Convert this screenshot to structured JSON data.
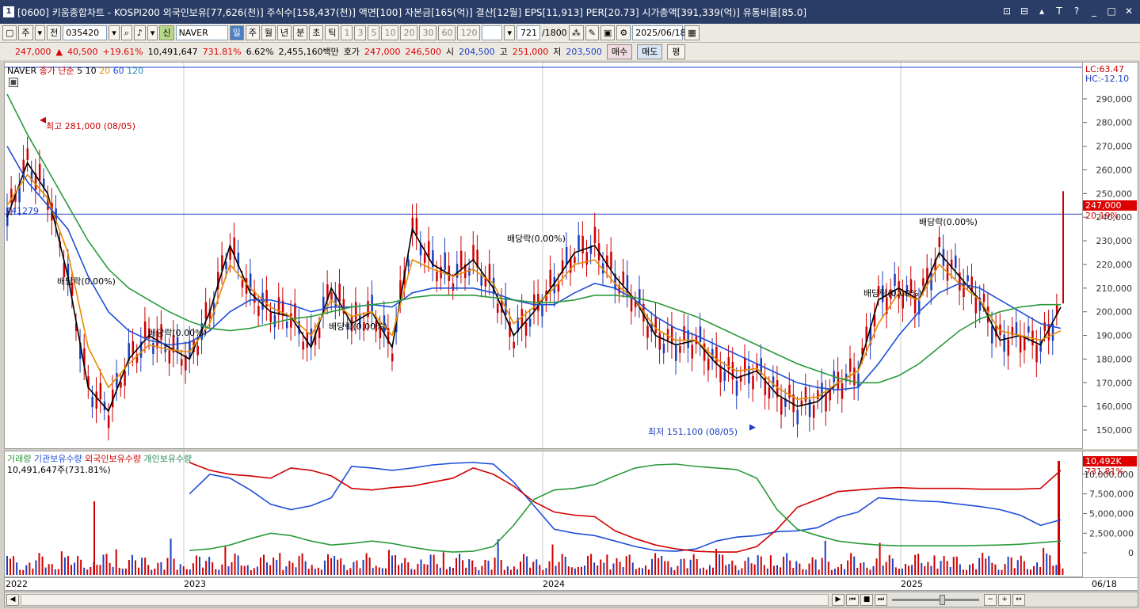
{
  "window": {
    "id": "1",
    "title": "[0600] 키움종합차트 - KOSPI200 외국인보유[77,626(천)] 주식수[158,437(천)] 액면[100] 자본금[165(억)] 결산[12월] EPS[11,913] PER[20.73] 시가총액[391,339(억)] 유통비율[85.0]",
    "buttons": [
      "⊡",
      "⊟",
      "▴",
      "T",
      "?",
      "_",
      "□",
      "✕"
    ]
  },
  "toolbar": {
    "mode_main": "주",
    "mode_all": "전",
    "code": "035420",
    "name": "NAVER",
    "badge": "신",
    "periods": [
      "일",
      "주",
      "월",
      "년",
      "분",
      "초",
      "틱"
    ],
    "active_period": "일",
    "intervals": [
      "1",
      "3",
      "5",
      "10",
      "20",
      "30",
      "60",
      "120"
    ],
    "count": "721",
    "count_total": "/1800",
    "date": "2025/06/18"
  },
  "price": {
    "current": "247,000",
    "arrow": "▲",
    "change": "40,500",
    "change_pct": "+19.61%",
    "volume": "10,491,647",
    "volume_pct": "731.81%",
    "turnover": "6.62%",
    "amount": "2,455,160백만",
    "quote_label": "호가",
    "ask": "247,000",
    "bid": "246,500",
    "open_label": "시",
    "open": "204,500",
    "high_label": "고",
    "high": "251,000",
    "low_label": "저",
    "low": "203,500",
    "buy": "매수",
    "sell": "매도",
    "eval": "평"
  },
  "main_legend": {
    "name": "NAVER",
    "ma_label": "종가 단순",
    "ma": [
      {
        "label": "5",
        "color": "#000000"
      },
      {
        "label": "10",
        "color": "#000000"
      },
      {
        "label": "20",
        "color": "#e88a00"
      },
      {
        "label": "60",
        "color": "#1f4fd8"
      },
      {
        "label": "120",
        "color": "#2a9a3a"
      }
    ]
  },
  "right_header": {
    "lc": "LC:63.47",
    "hc": "HC:-12.10"
  },
  "price_tag": {
    "value": "247,000",
    "pct": "20.19%"
  },
  "volume_tag": {
    "value": "10,492K",
    "pct": "731.81%"
  },
  "volume_legend": {
    "items": [
      {
        "label": "거래량",
        "color": "#2a9a3a"
      },
      {
        "label": "기관보유수량",
        "color": "#1f4fd8"
      },
      {
        "label": "외국인보유수량",
        "color": "#d00000"
      },
      {
        "label": "개인보유수량",
        "color": "#2a8a5a"
      }
    ],
    "volume_text": "10,491,647주(731.81%)"
  },
  "ref_line": {
    "value": 241279,
    "label": "241279"
  },
  "annotations": {
    "high": "최고 281,000 (08/05)",
    "low": "최저 151,100 (08/05)",
    "dividends": [
      "배당락(0.00%)",
      "배당락(0.00%)",
      "배당락(0.00%)",
      "배당락(0.00%)",
      "배당락(0.00%)",
      "배당락(0.00%)"
    ]
  },
  "date_axis": {
    "labels": [
      "2022",
      "2023",
      "2024",
      "2025",
      "06/18"
    ]
  },
  "scroll_buttons": [
    "◀",
    "▶",
    "⏮",
    "■",
    "⏭",
    "−",
    "+",
    "↔"
  ],
  "chart_data": [
    {
      "type": "line",
      "title": "NAVER",
      "ylim": [
        145000,
        300000
      ],
      "yticks": [
        "290,000",
        "280,000",
        "270,000",
        "260,000",
        "250,000",
        "240,000",
        "230,000",
        "220,000",
        "210,000",
        "200,000",
        "190,000",
        "180,000",
        "170,000",
        "160,000",
        "150,000"
      ],
      "series": [
        {
          "name": "5",
          "color": "#000000",
          "values": [
            240000,
            263000,
            250000,
            215000,
            168000,
            158000,
            180000,
            190000,
            185000,
            180000,
            200000,
            228000,
            208000,
            200000,
            198000,
            185000,
            210000,
            195000,
            200000,
            185000,
            235000,
            220000,
            215000,
            222000,
            210000,
            190000,
            200000,
            212000,
            225000,
            228000,
            215000,
            205000,
            190000,
            186000,
            188000,
            178000,
            172000,
            175000,
            165000,
            160000,
            162000,
            170000,
            175000,
            205000,
            210000,
            205000,
            225000,
            215000,
            205000,
            188000,
            190000,
            186000,
            202000
          ]
        },
        {
          "name": "20",
          "color": "#e88a00",
          "values": [
            245000,
            258000,
            248000,
            225000,
            185000,
            168000,
            178000,
            186000,
            184000,
            183000,
            195000,
            220000,
            210000,
            202000,
            198000,
            190000,
            205000,
            198000,
            200000,
            190000,
            222000,
            218000,
            215000,
            218000,
            212000,
            195000,
            202000,
            210000,
            220000,
            222000,
            212000,
            205000,
            193000,
            188000,
            188000,
            180000,
            175000,
            176000,
            168000,
            163000,
            164000,
            170000,
            175000,
            195000,
            208000,
            205000,
            220000,
            212000,
            205000,
            192000,
            190000,
            188000,
            192000
          ]
        },
        {
          "name": "60",
          "color": "#1f4fd8",
          "values": [
            270000,
            255000,
            245000,
            235000,
            215000,
            200000,
            192000,
            188000,
            186000,
            187000,
            192000,
            200000,
            205000,
            205000,
            203000,
            200000,
            202000,
            202000,
            203000,
            202000,
            208000,
            210000,
            210000,
            210000,
            208000,
            205000,
            203000,
            203000,
            208000,
            212000,
            210000,
            205000,
            198000,
            193000,
            190000,
            186000,
            182000,
            178000,
            174000,
            170000,
            168000,
            167000,
            168000,
            178000,
            190000,
            200000,
            208000,
            212000,
            210000,
            205000,
            200000,
            195000,
            193000
          ]
        },
        {
          "name": "120",
          "color": "#2a9a3a",
          "values": [
            292000,
            275000,
            260000,
            245000,
            230000,
            218000,
            210000,
            205000,
            200000,
            196000,
            193000,
            192000,
            193000,
            195000,
            197000,
            198000,
            200000,
            202000,
            203000,
            204000,
            206000,
            207000,
            207000,
            207000,
            206000,
            205000,
            204000,
            204000,
            205000,
            207000,
            207000,
            206000,
            204000,
            201000,
            198000,
            194000,
            190000,
            186000,
            182000,
            178000,
            175000,
            172000,
            170000,
            170000,
            173000,
            178000,
            185000,
            192000,
            197000,
            200000,
            202000,
            203000,
            203000
          ]
        }
      ]
    },
    {
      "type": "line",
      "title": "거래량",
      "ylim": [
        -1000000,
        11500000
      ],
      "yticks": [
        "10,000,000",
        "7,500,000",
        "5,000,000",
        "2,500,000",
        "0"
      ],
      "series": [
        {
          "name": "기관보유수량",
          "color": "#1f4fd8",
          "values": [
            null,
            null,
            null,
            null,
            null,
            null,
            null,
            null,
            null,
            7500000,
            10000000,
            9500000,
            8000000,
            6200000,
            5500000,
            6000000,
            7000000,
            11000000,
            10800000,
            10500000,
            10800000,
            11200000,
            11400000,
            11500000,
            11300000,
            9000000,
            6000000,
            3000000,
            2500000,
            2200000,
            1500000,
            800000,
            300000,
            200000,
            500000,
            1500000,
            2000000,
            2200000,
            2700000,
            2800000,
            3200000,
            4500000,
            5200000,
            7000000,
            6800000,
            6600000,
            6500000,
            6200000,
            5900000,
            5500000,
            4800000,
            3500000,
            4200000
          ]
        },
        {
          "name": "외국인보유수량",
          "color": "#d00000",
          "values": [
            null,
            null,
            null,
            null,
            null,
            null,
            null,
            null,
            null,
            11500000,
            10500000,
            10000000,
            9800000,
            9500000,
            10800000,
            10500000,
            9800000,
            8200000,
            8000000,
            8300000,
            8500000,
            9000000,
            9500000,
            10800000,
            10000000,
            8500000,
            6500000,
            5200000,
            4800000,
            4600000,
            2800000,
            1800000,
            1000000,
            500000,
            200000,
            100000,
            100000,
            800000,
            3000000,
            5800000,
            6800000,
            7800000,
            8000000,
            8200000,
            8300000,
            8200000,
            8200000,
            8200000,
            8100000,
            8100000,
            8100000,
            8200000,
            10500000
          ]
        },
        {
          "name": "개인보유수량",
          "color": "#2a9a3a",
          "values": [
            null,
            null,
            null,
            null,
            null,
            null,
            null,
            null,
            null,
            300000,
            500000,
            1000000,
            1800000,
            2500000,
            2200000,
            1500000,
            1000000,
            1200000,
            1500000,
            1200000,
            700000,
            300000,
            100000,
            200000,
            800000,
            3500000,
            6800000,
            8000000,
            8200000,
            8700000,
            9800000,
            10800000,
            11200000,
            11300000,
            11000000,
            10800000,
            10600000,
            9500000,
            5500000,
            3000000,
            2200000,
            1500000,
            1200000,
            1000000,
            900000,
            900000,
            900000,
            900000,
            950000,
            1000000,
            1100000,
            1300000,
            1500000
          ]
        }
      ]
    }
  ]
}
